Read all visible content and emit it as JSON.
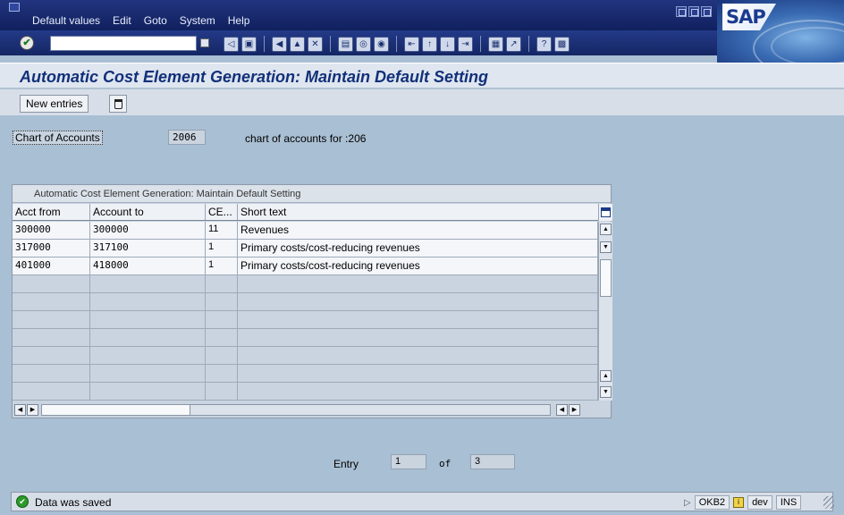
{
  "menubar": {
    "items": [
      {
        "label": "Default values"
      },
      {
        "label": "Edit"
      },
      {
        "label": "Goto"
      },
      {
        "label": "System"
      },
      {
        "label": "Help"
      }
    ],
    "logo_text": "SAP"
  },
  "toolbar": {
    "command_value": "",
    "icons": [
      "back-icon",
      "save-icon",
      "back-arrow-icon",
      "exit-icon",
      "cancel-icon",
      "print-icon",
      "find-icon",
      "find-next-icon",
      "first-page-icon",
      "previous-page-icon",
      "next-page-icon",
      "last-page-icon",
      "create-session-icon",
      "shortcut-icon",
      "help-icon",
      "customize-layout-icon"
    ]
  },
  "page": {
    "title": "Automatic Cost Element Generation: Maintain Default Setting"
  },
  "app_toolbar": {
    "new_entries_label": "New entries"
  },
  "chart_of_accounts": {
    "label": "Chart of Accounts",
    "value": "2006",
    "description": "chart of accounts for :206"
  },
  "table": {
    "title": "Automatic Cost Element Generation: Maintain Default Setting",
    "columns": [
      "Acct from",
      "Account to",
      "CE...",
      "Short text"
    ],
    "rows": [
      {
        "from": "300000",
        "to": "300000",
        "ce": "11",
        "text": "Revenues"
      },
      {
        "from": "317000",
        "to": "317100",
        "ce": "1",
        "text": "Primary costs/cost-reducing revenues"
      },
      {
        "from": "401000",
        "to": "418000",
        "ce": "1",
        "text": "Primary costs/cost-reducing revenues"
      }
    ],
    "empty_rows": 7
  },
  "entry": {
    "label": "Entry",
    "current": "1",
    "of_label": "of",
    "total": "3"
  },
  "statusbar": {
    "message": "Data was saved",
    "transaction": "OKB2",
    "system": "dev",
    "mode": "INS"
  },
  "colors": {
    "background": "#a9bfd3",
    "menubar": "#1a2c70",
    "title": "#12307a"
  }
}
